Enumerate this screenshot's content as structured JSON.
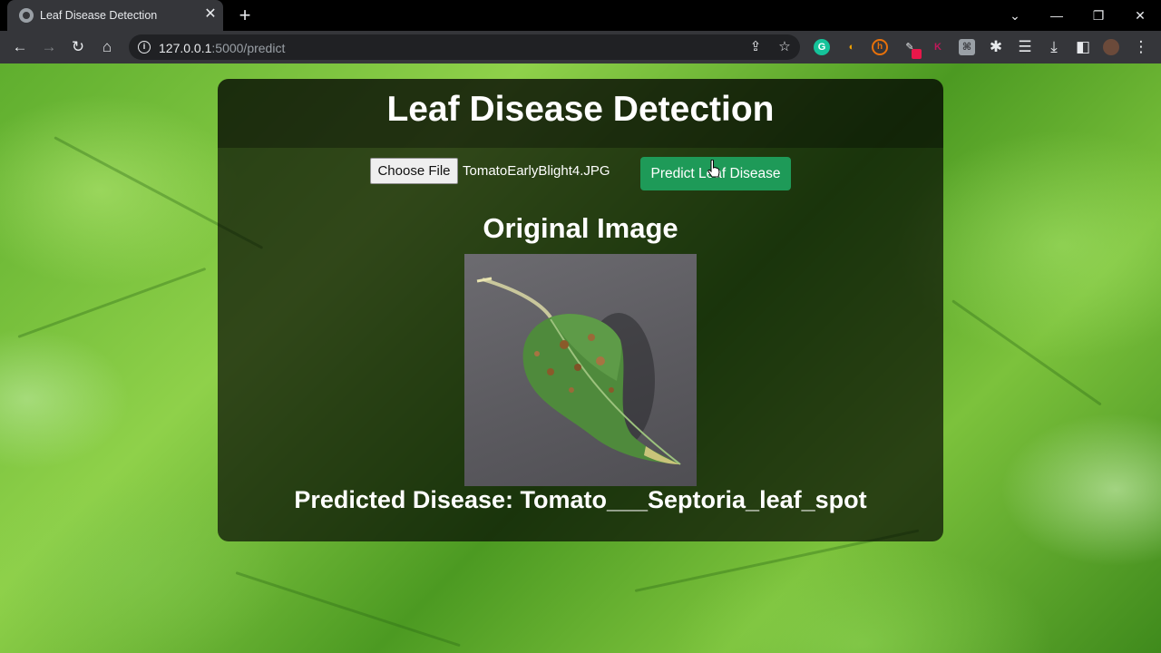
{
  "browser": {
    "tab_title": "Leaf Disease Detection",
    "url_host": "127.0.0.1",
    "url_path": ":5000/predict"
  },
  "page": {
    "title": "Leaf Disease Detection",
    "choose_file_label": "Choose File",
    "selected_file": "TomatoEarlyBlight4.JPG",
    "predict_label": "Predict Leaf Disease",
    "original_image_heading": "Original Image",
    "result_text": "Predicted Disease: Tomato___Septoria_leaf_spot"
  },
  "colors": {
    "predict_button": "#1e9a58",
    "panel_overlay": "#000000",
    "chrome_dark": "#35363a"
  },
  "icons": {
    "tab_favicon": "globe-icon",
    "close": "close-icon",
    "back": "back-arrow-icon",
    "forward": "forward-arrow-icon",
    "reload": "reload-icon",
    "home": "home-icon",
    "site_info": "info-icon",
    "share": "share-icon",
    "bookmark": "star-icon",
    "extensions": "puzzle-icon",
    "downloads": "download-icon",
    "menu": "kebab-menu-icon"
  }
}
